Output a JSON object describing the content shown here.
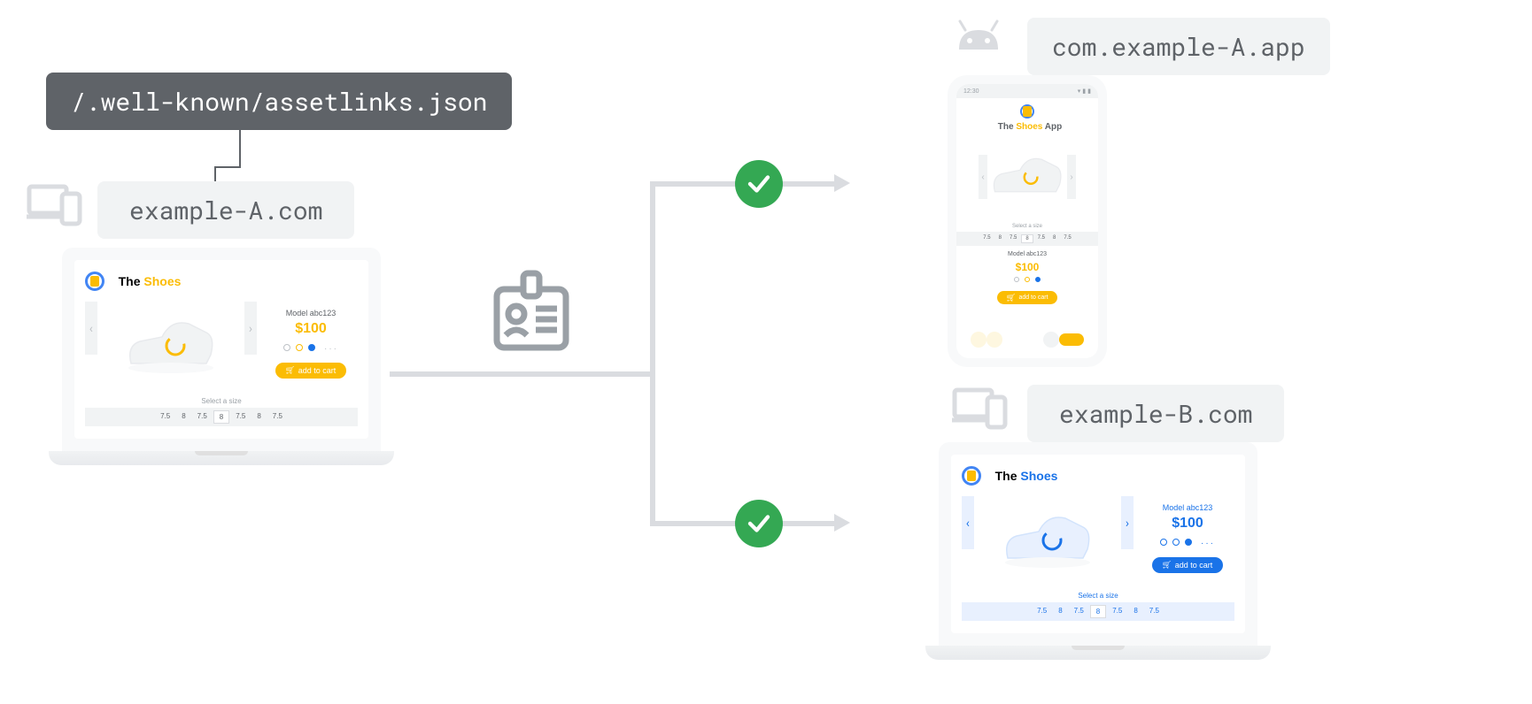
{
  "assetlinks_path": "/.well-known/assetlinks.json",
  "source_domain": "example-A.com",
  "app_package": "com.example-A.app",
  "target_domain": "example-B.com",
  "brand": {
    "the": "The ",
    "shoes": "Shoes",
    "app_suffix": " App"
  },
  "product": {
    "model": "Model abc123",
    "price": "$100",
    "cta": "add to cart",
    "size_label": "Select a size",
    "sizes": [
      "7.5",
      "8",
      "7.5",
      "8",
      "7.5",
      "8",
      "7.5"
    ],
    "selected_size_index": 3
  },
  "phone": {
    "time": "12:30"
  }
}
